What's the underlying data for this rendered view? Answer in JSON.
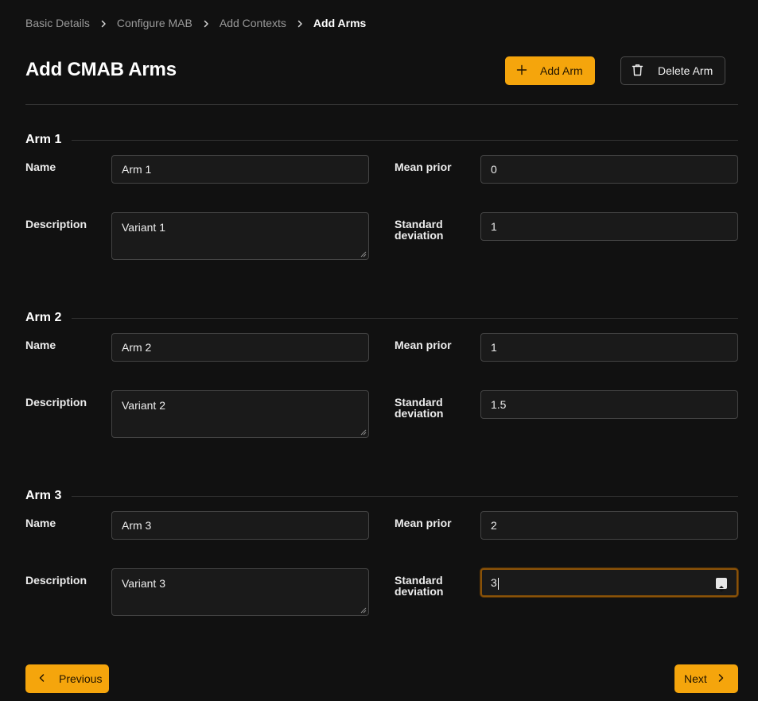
{
  "breadcrumb": [
    {
      "label": "Basic Details"
    },
    {
      "label": "Configure MAB"
    },
    {
      "label": "Add Contexts"
    },
    {
      "label": "Add Arms"
    }
  ],
  "header": {
    "title": "Add CMAB Arms",
    "add_label": "Add Arm",
    "delete_label": "Delete Arm"
  },
  "labels": {
    "name": "Name",
    "description": "Description",
    "mean_prior": "Mean prior",
    "standard_deviation": "Standard deviation"
  },
  "arms": [
    {
      "title": "Arm 1",
      "name": "Arm 1",
      "description": "Variant 1",
      "mean_prior": "0",
      "standard_deviation": "1"
    },
    {
      "title": "Arm 2",
      "name": "Arm 2",
      "description": "Variant 2",
      "mean_prior": "1",
      "standard_deviation": "1.5"
    },
    {
      "title": "Arm 3",
      "name": "Arm 3",
      "description": "Variant 3",
      "mean_prior": "2",
      "standard_deviation": "3"
    }
  ],
  "footer": {
    "previous_label": "Previous",
    "next_label": "Next"
  },
  "colors": {
    "accent": "#f5a50c",
    "background": "#111111",
    "focus_ring": "#8a5208"
  }
}
